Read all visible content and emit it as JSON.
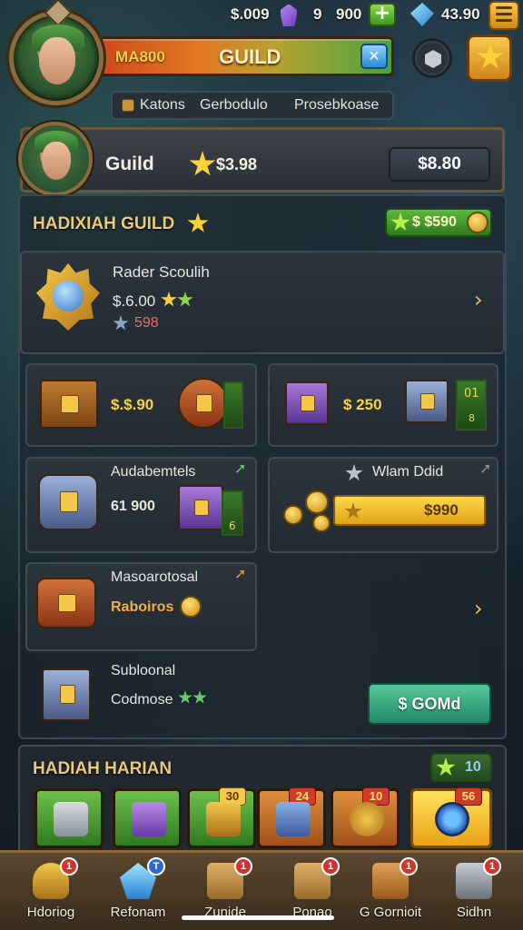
{
  "resources": {
    "coins": "$.009",
    "gems_purple": "9",
    "gold": "900",
    "crystals": "43.90"
  },
  "header": {
    "guild_tag": "MA800",
    "guild_label": "GUILD",
    "tabs": [
      {
        "label": "Katons"
      },
      {
        "label": "Gerbodulo"
      },
      {
        "label": "Prosebkoase"
      }
    ]
  },
  "player": {
    "name": "Guild",
    "score": "$3.98",
    "button_label": "$8.80"
  },
  "guild_section": {
    "title": "HADIXIAH GUILD",
    "pill_value": "$ $590"
  },
  "feature": {
    "title": "Rader Scoulih",
    "value": "$.6.00",
    "sub_value": "598"
  },
  "cards": {
    "card1_value": "$.$.90",
    "card2_value": "$ 250",
    "card2_gauge_top": "01",
    "card2_gauge_bottom": "8",
    "card3_title": "Audabemtels",
    "card3_value": "61 900",
    "card3_gauge": "6",
    "card4_title": "Wlam Ddid",
    "card4_bar_value": "$990",
    "card5_title": "Masoarotosal",
    "card5_value": "Raboiros",
    "card6_title": "Subloonal",
    "card6_value": "Codmose",
    "card6_button": "$ GOMd"
  },
  "hadiah_section": {
    "title": "HADIAH HARIAN",
    "pill_value": "10",
    "slot_badges": [
      "",
      "",
      "30",
      "24",
      "10",
      "56"
    ]
  },
  "nav": [
    {
      "label": "Hdoriog",
      "badge": "1"
    },
    {
      "label": "Refonam",
      "badge": "T"
    },
    {
      "label": "Zunide",
      "badge": "1"
    },
    {
      "label": "Ponao",
      "badge": "1"
    },
    {
      "label": "G Gornioit",
      "badge": "1"
    },
    {
      "label": "Sidhn",
      "badge": "1"
    }
  ],
  "colors": {
    "accent_gold": "#f6d24a",
    "accent_green": "#5cb83e",
    "accent_teal": "#23886a",
    "nav_bg": "#3a2c1c"
  }
}
